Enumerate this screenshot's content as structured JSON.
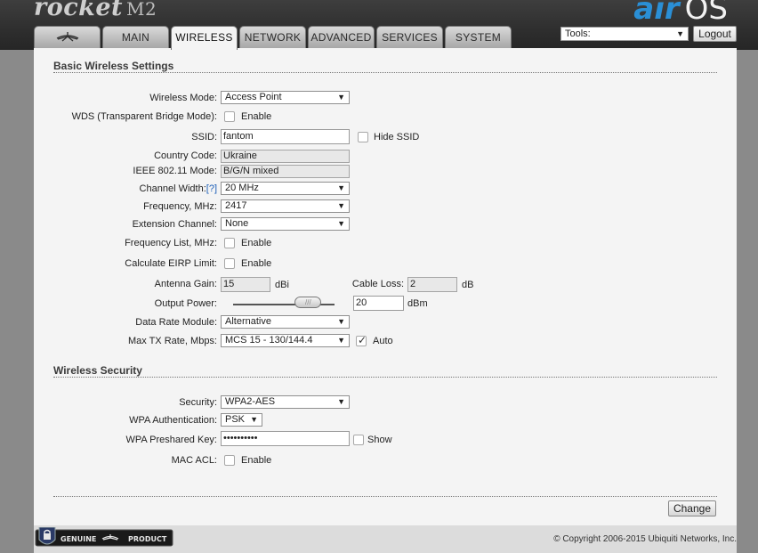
{
  "header": {
    "product_name": "rocket",
    "product_model": "M2",
    "brand_air": "air",
    "brand_os": "OS"
  },
  "tabs": [
    {
      "label": "",
      "icon": "ubiquiti-logo-icon"
    },
    {
      "label": "MAIN"
    },
    {
      "label": "WIRELESS",
      "active": true
    },
    {
      "label": "NETWORK"
    },
    {
      "label": "ADVANCED"
    },
    {
      "label": "SERVICES"
    },
    {
      "label": "SYSTEM"
    }
  ],
  "tools": {
    "selected": "Tools:"
  },
  "logout_label": "Logout",
  "basic": {
    "title": "Basic Wireless Settings",
    "wireless_mode": {
      "label": "Wireless Mode:",
      "value": "Access Point"
    },
    "wds": {
      "label": "WDS (Transparent Bridge Mode):",
      "option": "Enable",
      "checked": false
    },
    "ssid": {
      "label": "SSID:",
      "value": "fantom",
      "hide_label": "Hide SSID",
      "hide_checked": false
    },
    "country_code": {
      "label": "Country Code:",
      "value": "Ukraine"
    },
    "ieee_mode": {
      "label": "IEEE 802.11 Mode:",
      "value": "B/G/N mixed"
    },
    "channel_width": {
      "label": "Channel Width:",
      "help": "[?]",
      "value": "20 MHz"
    },
    "frequency": {
      "label": "Frequency, MHz:",
      "value": "2417"
    },
    "extension_channel": {
      "label": "Extension Channel:",
      "value": "None"
    },
    "frequency_list": {
      "label": "Frequency List, MHz:",
      "option": "Enable",
      "checked": false
    },
    "eirp_limit": {
      "label": "Calculate EIRP Limit:",
      "option": "Enable",
      "checked": false
    },
    "antenna_gain": {
      "label": "Antenna Gain:",
      "value": "15",
      "unit": "dBi"
    },
    "cable_loss": {
      "label": "Cable Loss:",
      "value": "2",
      "unit": "dB"
    },
    "output_power": {
      "label": "Output Power:",
      "value": "20",
      "unit": "dBm",
      "slider_fraction": 0.74
    },
    "data_rate_module": {
      "label": "Data Rate Module:",
      "value": "Alternative"
    },
    "max_tx_rate": {
      "label": "Max TX Rate, Mbps:",
      "value": "MCS 15 - 130/144.4",
      "auto_label": "Auto",
      "auto_checked": true
    }
  },
  "security": {
    "title": "Wireless Security",
    "security": {
      "label": "Security:",
      "value": "WPA2-AES"
    },
    "wpa_auth": {
      "label": "WPA Authentication:",
      "value": "PSK"
    },
    "wpa_key": {
      "label": "WPA Preshared Key:",
      "value": "••••••••••",
      "show_label": "Show",
      "show_checked": false
    },
    "mac_acl": {
      "label": "MAC ACL:",
      "option": "Enable",
      "checked": false
    }
  },
  "change_label": "Change",
  "footer": {
    "badge_left": "GENUINE",
    "badge_right": "PRODUCT",
    "copyright": "© Copyright 2006-2015 Ubiquiti Networks, Inc."
  },
  "colors": {
    "accent_blue": "#2a8fd6",
    "help_link": "#1d5fb8",
    "topbar": "#2c2c2c"
  }
}
